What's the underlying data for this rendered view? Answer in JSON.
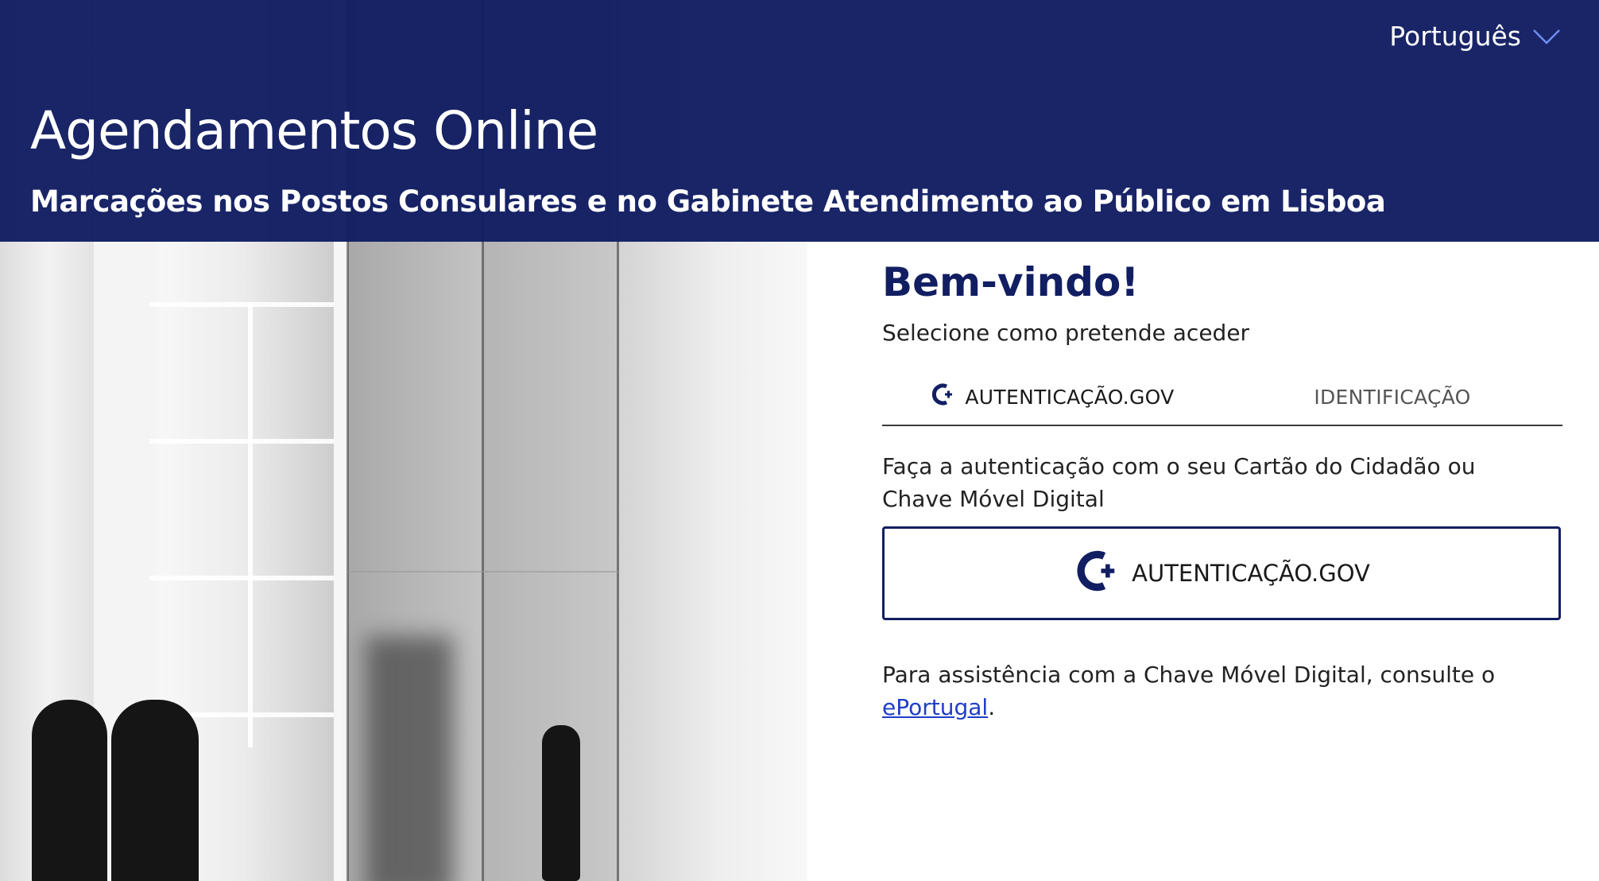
{
  "header": {
    "title": "Agendamentos Online",
    "subtitle": "Marcações nos Postos Consulares e no Gabinete Atendimento ao Público em Lisboa",
    "language": {
      "selected": "Português",
      "icon": "chevron-down-icon"
    }
  },
  "main": {
    "heading": "Bem-vindo!",
    "prompt": "Selecione como pretende aceder",
    "tabs": [
      {
        "label": "AUTENTICAÇÃO.GOV",
        "icon": "autenticacao-gov-logo-icon",
        "active": true
      },
      {
        "label": "IDENTIFICAÇÃO",
        "active": false
      }
    ],
    "description": "Faça a autenticação com o seu Cartão do Cidadão ou Chave Móvel Digital",
    "auth_button": {
      "label": "AUTENTICAÇÃO.GOV",
      "icon": "autenticacao-gov-logo-icon"
    },
    "help": {
      "text": "Para assistência com a Chave Móvel Digital, consulte o",
      "link": "ePortugal",
      "suffix": "."
    }
  },
  "colors": {
    "header_bg": "#121e62",
    "accent": "#121e62",
    "link": "#1f3ec8",
    "text": "#222222"
  }
}
